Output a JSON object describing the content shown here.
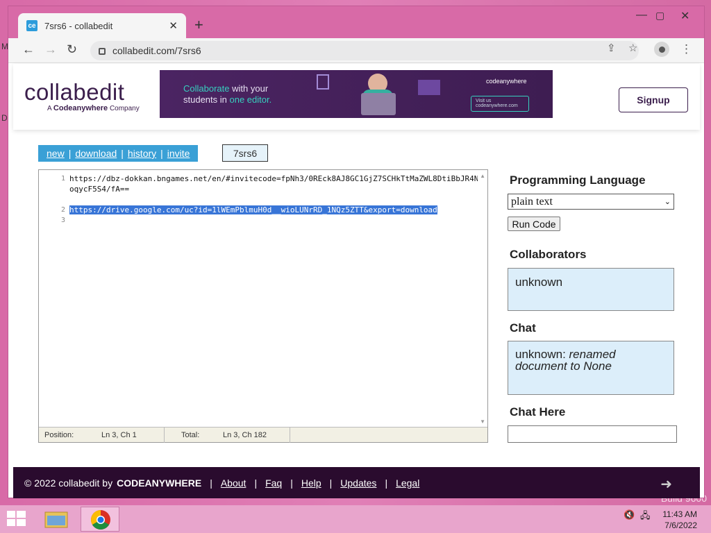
{
  "desktop": {
    "watermark": "Build 9600"
  },
  "browser": {
    "favicon_text": "ce",
    "tab_title": "7srs6 - collabedit",
    "url": "collabedit.com/7srs6"
  },
  "site": {
    "logo": "collabedit",
    "tagline_prefix": "A",
    "tagline_brand": "Codeanywhere",
    "tagline_suffix": "Company",
    "signup": "Signup"
  },
  "banner": {
    "word1": "Collaborate",
    "word2": "with your",
    "word3": "students in",
    "word4": "one editor.",
    "brand": "codeanywhere",
    "visit": "Visit us",
    "visit_url": "codeanywhere.com"
  },
  "nav": {
    "new": "new",
    "download": "download",
    "history": "history",
    "invite": "invite",
    "doc_id": "7srs6"
  },
  "editor": {
    "line_numbers": [
      "1",
      "2",
      "3"
    ],
    "lines": [
      "https://dbz-dokkan.bngames.net/en/#invitecode=fpNh3/0REck8AJ8GC1GjZ7SCHkTtMaZWL8DtiBbJR4NoqycF5S4/fA==",
      "",
      "https://drive.google.com/uc?id=1lWEmPblmuH0d__wioLUNrRD_1NQz5ZTT&export=download"
    ],
    "status": {
      "position_label": "Position:",
      "position_value": "Ln 3, Ch 1",
      "total_label": "Total:",
      "total_value": "Ln 3, Ch 182"
    }
  },
  "sidebar": {
    "language_heading": "Programming Language",
    "language_value": "plain text",
    "run_button": "Run Code",
    "collaborators_heading": "Collaborators",
    "collaborators": [
      "unknown"
    ],
    "chat_heading": "Chat",
    "chat_messages": [
      {
        "author": "unknown",
        "text": "renamed document to None"
      }
    ],
    "chat_here_heading": "Chat Here"
  },
  "footer": {
    "copyright": "© 2022 collabedit by",
    "brand": "CODEANYWHERE",
    "links": [
      "About",
      "Faq",
      "Help",
      "Updates",
      "Legal"
    ]
  },
  "taskbar": {
    "time": "11:43 AM",
    "date": "7/6/2022"
  }
}
